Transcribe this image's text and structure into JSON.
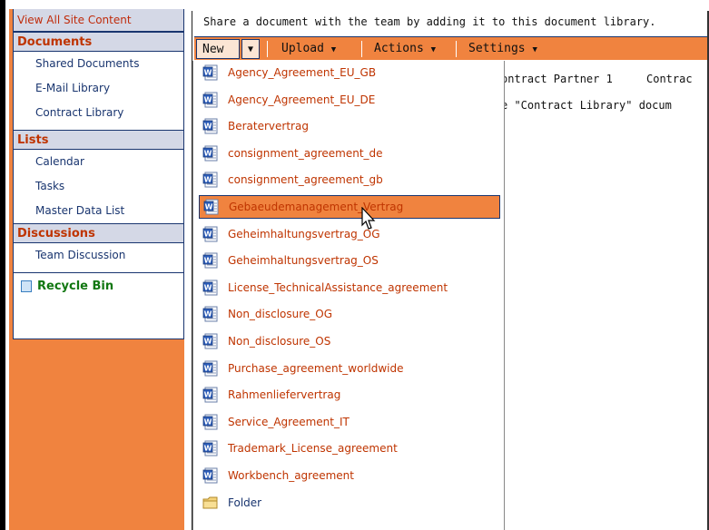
{
  "sidebar": {
    "view_all": "View All Site Content",
    "sections": [
      {
        "header": "Documents",
        "items": [
          "Shared Documents",
          "E-Mail Library",
          "Contract Library"
        ]
      },
      {
        "header": "Lists",
        "items": [
          "Calendar",
          "Tasks",
          "Master Data List"
        ]
      },
      {
        "header": "Discussions",
        "items": [
          "Team Discussion"
        ]
      }
    ],
    "recycle_bin": "Recycle Bin"
  },
  "main": {
    "description": "Share a document with the team by adding it to this document library.",
    "toolbar": {
      "new": "New",
      "upload": "Upload",
      "actions": "Actions",
      "settings": "Settings"
    },
    "behind_text": {
      "col_a": "ontract Partner 1",
      "col_b": "Contrac",
      "line2": "e \"Contract Library\" docum"
    }
  },
  "new_menu": {
    "items": [
      "Agency_Agreement_EU_GB",
      "Agency_Agreement_EU_DE",
      "Beratervertrag",
      "consignment_agreement_de",
      "consignment_agreement_gb",
      "Gebaeudemanagement_Vertrag",
      "Geheimhaltungsvertrag_OG",
      "Geheimhaltungsvertrag_OS",
      "License_TechnicalAssistance_agreement",
      "Non_disclosure_OG",
      "Non_disclosure_OS",
      "Purchase_agreement_worldwide",
      "Rahmenliefervertrag",
      "Service_Agreement_IT",
      "Trademark_License_agreement",
      "Workbench_agreement"
    ],
    "folder": "Folder",
    "highlighted": "Gebaeudemanagement_Vertrag",
    "item_icon": "word-document-icon",
    "folder_icon": "folder-icon"
  },
  "colors": {
    "accent": "#f0833f",
    "nav_text": "#19356f",
    "header_text": "#bf3400",
    "link_red": "#bf3400",
    "recycle_green": "#117711"
  }
}
